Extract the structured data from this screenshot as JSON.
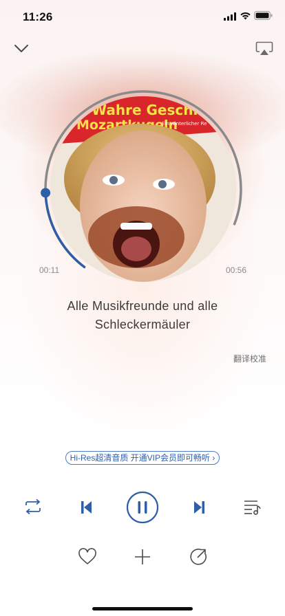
{
  "status_bar": {
    "time": "11:26"
  },
  "player": {
    "cover": {
      "line1": "Wahre Geschichte",
      "line2": "Mozartkugeln",
      "tagline": "Ein winterlicher Re"
    },
    "elapsed": "00:11",
    "duration": "00:56",
    "progress": 0.2,
    "track_title_line1": "Alle Musikfreunde und alle",
    "track_title_line2": "Schleckermäuler",
    "translate_label": "翻译校准",
    "promo_text": "Hi-Res超清音质 开通VIP会员即可畅听 ›"
  },
  "colors": {
    "accent": "#2d5ea6",
    "progress_bg": "#8a8a8a"
  },
  "icons": {
    "collapse": "chevron-down-icon",
    "airplay": "airplay-icon",
    "repeat": "repeat-icon",
    "previous": "previous-icon",
    "pause": "pause-icon",
    "next": "next-icon",
    "playlist": "playlist-icon",
    "favorite": "heart-icon",
    "add": "plus-icon",
    "share": "share-icon"
  }
}
